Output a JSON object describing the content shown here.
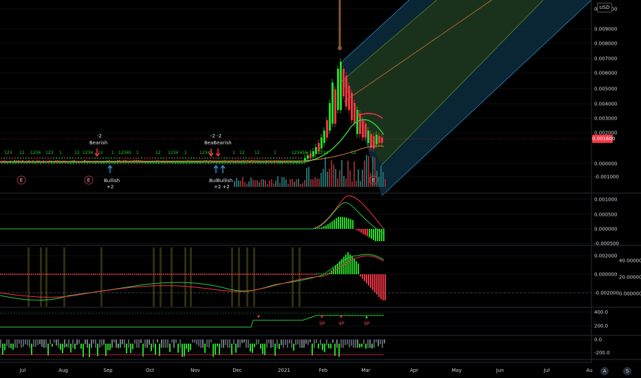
{
  "price_scale": {
    "currency": "USD",
    "main": [
      "0.010000",
      "0.009000",
      "0.008000",
      "0.007000",
      "0.006000",
      "0.005000",
      "0.004000",
      "0.003000",
      "0.002000",
      "0.000000",
      "-0.001000"
    ],
    "current_price": "0.001600",
    "macd": [
      "0.001000",
      "0.000500",
      "0.000000",
      "-0.000500"
    ],
    "osc": [
      "0.002000",
      "0.000000",
      "-0.002000"
    ],
    "osc_right": [
      "40.000000",
      "20.000000",
      "0.000000"
    ],
    "cci": [
      "400.0",
      "200.0",
      "0.0",
      "-200.0"
    ]
  },
  "time_axis": [
    "Jul",
    "Aug",
    "Sep",
    "Oct",
    "Nov",
    "Dec",
    "2021",
    "Feb",
    "Mar",
    "Apr",
    "May",
    "Jun",
    "Jul",
    "Au"
  ],
  "annotations": {
    "bearish_1_count": "-2",
    "bearish_1": "Bearish",
    "bullish_1": "Bullish",
    "bullish_1_count": "+2",
    "bearish_2_count": "-2  -2",
    "bearish_2": "BeaBearish",
    "bullish_2": "BulBullish",
    "bullish_2_count": "+2 +2",
    "earnings_marker": "E",
    "count_labels": [
      "123",
      "12",
      "1234",
      "123",
      "1",
      "12",
      "1234",
      "12",
      "1",
      "12345",
      "1",
      "12",
      "1234",
      "1",
      "12345",
      "1",
      "12",
      "12",
      "1",
      "123456",
      "1",
      "1234",
      "12"
    ],
    "sell_pattern": "9P",
    "buy_pattern": "9P"
  },
  "corner_icons": {
    "auto_label": "A",
    "settings_label": "S"
  },
  "colors": {
    "up": "#26d926",
    "down": "#f23645",
    "bull_band_fill": "#1d3a1a",
    "bear_band_fill": "#0d2a3a",
    "grid": "#1c1f26",
    "price_line": "#f23645"
  }
}
